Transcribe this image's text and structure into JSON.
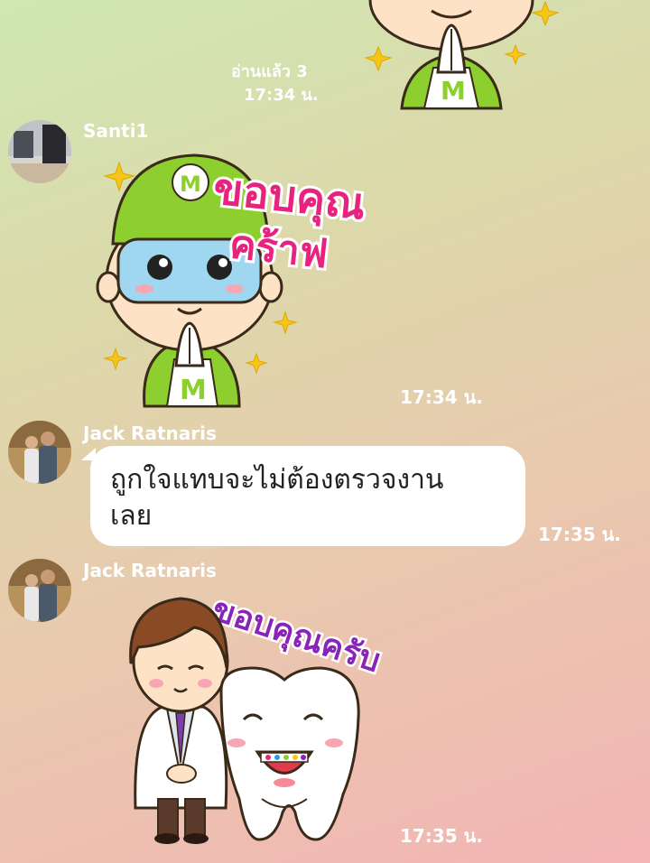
{
  "messages": [
    {
      "kind": "sticker-outgoing",
      "read_receipt": "อ่านแล้ว 3",
      "time": "17:34 น."
    },
    {
      "kind": "sticker",
      "sender": "Santi1",
      "sticker_text": [
        "ขอบคุณ",
        "คร้าฟ"
      ],
      "time": "17:34 น."
    },
    {
      "kind": "text",
      "sender": "Jack Ratnaris",
      "text_lines": [
        "ถูกใจแทบจะไม่ต้องตรวจงาน",
        "เลย"
      ],
      "time": "17:35 น."
    },
    {
      "kind": "sticker",
      "sender": "Jack Ratnaris",
      "sticker_text": "ขอบคุณครับ",
      "time": "17:35 น."
    }
  ],
  "colors": {
    "bubble": "#ffffff",
    "meta_text": "#ffffff",
    "sticker_pink": "#e8237d",
    "sticker_purple": "#8a23b8",
    "cap_green": "#8ccf2e"
  },
  "icons": [
    "avatar-santi1",
    "avatar-jack-ratnaris",
    "sticker-green-cap-boy",
    "sticker-dentist-tooth"
  ]
}
